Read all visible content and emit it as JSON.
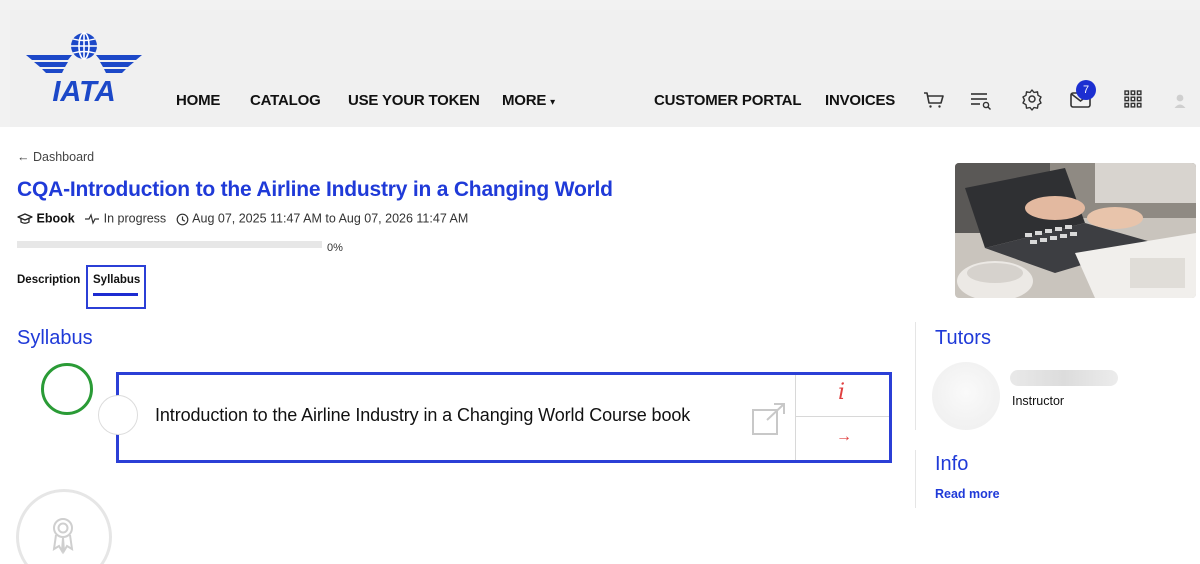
{
  "header": {
    "logo_text": "IATA",
    "nav": {
      "home": "HOME",
      "catalog": "CATALOG",
      "token": "USE YOUR TOKEN",
      "more": "MORE",
      "portal": "CUSTOMER PORTAL",
      "invoices": "INVOICES"
    },
    "icons": [
      "cart-icon",
      "search-list-icon",
      "settings-icon",
      "mail-icon",
      "apps-grid-icon",
      "user-avatar-icon"
    ],
    "notification_count": "7",
    "colors": {
      "brand": "#1f3ad8",
      "logo_blue": "#1c48c8",
      "badge": "#1c2fd1"
    }
  },
  "breadcrumb": {
    "text": "Dashboard"
  },
  "course": {
    "title": "CQA-Introduction to the Airline Industry in a Changing World",
    "type": "Ebook",
    "status": "In progress",
    "dates": "Aug 07, 2025 11:47 AM to Aug 07, 2026 11:47 AM",
    "progress": 0,
    "progress_label": "0%"
  },
  "tabs": {
    "description": "Description",
    "syllabus": "Syllabus",
    "active": "Syllabus"
  },
  "syllabus": {
    "heading": "Syllabus",
    "items": [
      {
        "title": "Introduction to the Airline Industry in a Changing World Course book",
        "info_label": "i",
        "go_label": "→"
      }
    ]
  },
  "tutors": {
    "heading": "Tutors",
    "list": [
      {
        "role": "Instructor"
      }
    ]
  },
  "info": {
    "heading": "Info",
    "read_more": "Read more"
  },
  "status_colors": {
    "completed_ring": "#2a9b36",
    "action": "#e04040"
  }
}
